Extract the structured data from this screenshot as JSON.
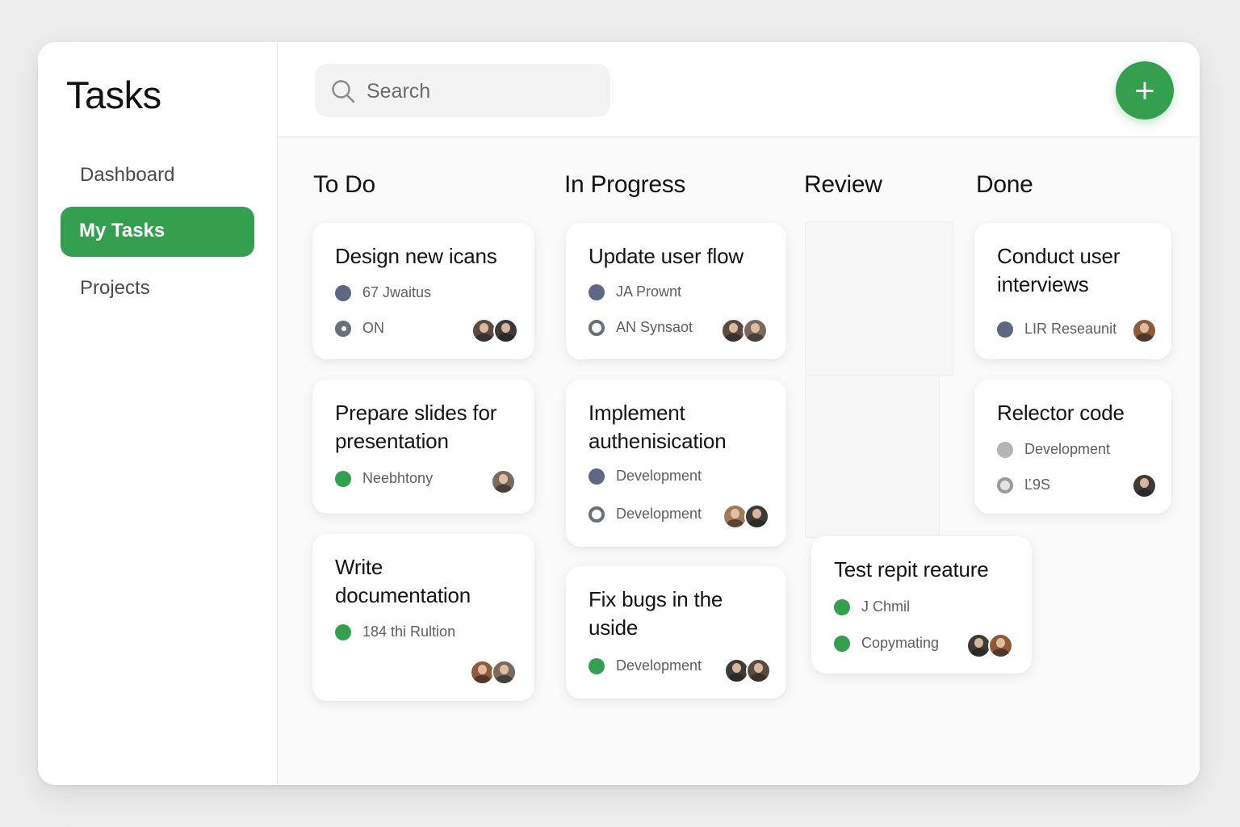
{
  "sidebar": {
    "app_title": "Tasks",
    "nav": [
      {
        "label": "Dashboard"
      },
      {
        "label": "My Tasks"
      },
      {
        "label": "Projects"
      }
    ]
  },
  "topbar": {
    "search": {
      "placeholder": "Search",
      "value": ""
    },
    "add_label": "+"
  },
  "colors": {
    "accent": "#34a04f",
    "tag_slate": "#5f6882",
    "tag_grey": "#b4b4b4"
  },
  "board": {
    "columns": [
      {
        "title": "To Do",
        "cards": [
          {
            "title": "Design new icans",
            "meta1": "67 Jwaitus",
            "meta2": "ON"
          },
          {
            "title": "Prepare slides for presentation",
            "meta1": "Neebhtony"
          },
          {
            "title": "Write documentation",
            "meta1": "184 thi Rultion"
          }
        ]
      },
      {
        "title": "In Progress",
        "cards": [
          {
            "title": "Update user flow",
            "meta1": "JA Prownt",
            "meta2": "AN Synsaot"
          },
          {
            "title": "Implement authenisication",
            "meta1": "Development",
            "meta2": "Development"
          },
          {
            "title": "Fix bugs in the uside",
            "meta1": "Development"
          }
        ]
      },
      {
        "title": "Review",
        "cards": [
          {
            "title": "Test repit reature",
            "meta1": "J Chmil",
            "meta2": "Copymating"
          }
        ]
      },
      {
        "title": "Done",
        "cards": [
          {
            "title": "Conduct user interviews",
            "meta1": "LIR Reseaunit"
          },
          {
            "title": "Relector code",
            "meta1": "Development",
            "meta2": "Ľ9S"
          }
        ]
      }
    ]
  }
}
